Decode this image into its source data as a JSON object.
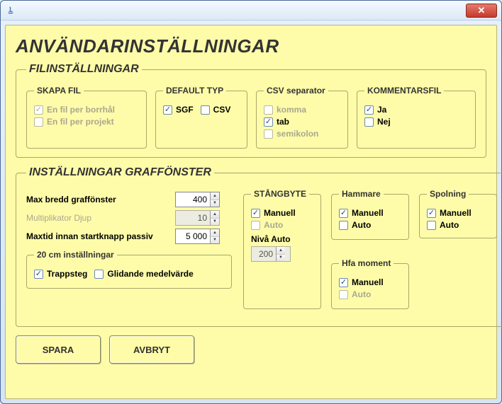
{
  "window": {
    "close": "✕"
  },
  "title": "ANVÄNDARINSTÄLLNINGAR",
  "filinst": {
    "legend": "FILINSTÄLLNINGAR",
    "skapa": {
      "legend": "SKAPA FIL",
      "opt1": "En fil per borrhål",
      "opt2": "En fil per projekt"
    },
    "deftyp": {
      "legend": "DEFAULT TYP",
      "sgf": "SGF",
      "csv": "CSV"
    },
    "csvsep": {
      "legend": "CSV separator",
      "komma": "komma",
      "tab": "tab",
      "semi": "semikolon"
    },
    "komm": {
      "legend": "KOMMENTARSFIL",
      "ja": "Ja",
      "nej": "Nej"
    }
  },
  "graf": {
    "legend": "INSTÄLLNINGAR GRAFFÖNSTER",
    "maxbredd": {
      "label": "Max bredd graffönster",
      "value": "400"
    },
    "multdjup": {
      "label": "Multiplikator Djup",
      "value": "10"
    },
    "maxtid": {
      "label": "Maxtid innan startknapp passiv",
      "value": "5 000"
    },
    "tjugo": {
      "legend": "20 cm inställningar",
      "trapp": "Trappsteg",
      "glid": "Glidande medelvärde"
    },
    "stang": {
      "legend": "STÅNGBYTE",
      "manuell": "Manuell",
      "auto": "Auto",
      "niva_label": "Nivå Auto",
      "niva_value": "200"
    },
    "hammare": {
      "legend": "Hammare",
      "manuell": "Manuell",
      "auto": "Auto"
    },
    "spolning": {
      "legend": "Spolning",
      "manuell": "Manuell",
      "auto": "Auto"
    },
    "hfa": {
      "legend": "Hfa moment",
      "manuell": "Manuell",
      "auto": "Auto"
    }
  },
  "buttons": {
    "save": "SPARA",
    "cancel": "AVBRYT"
  }
}
